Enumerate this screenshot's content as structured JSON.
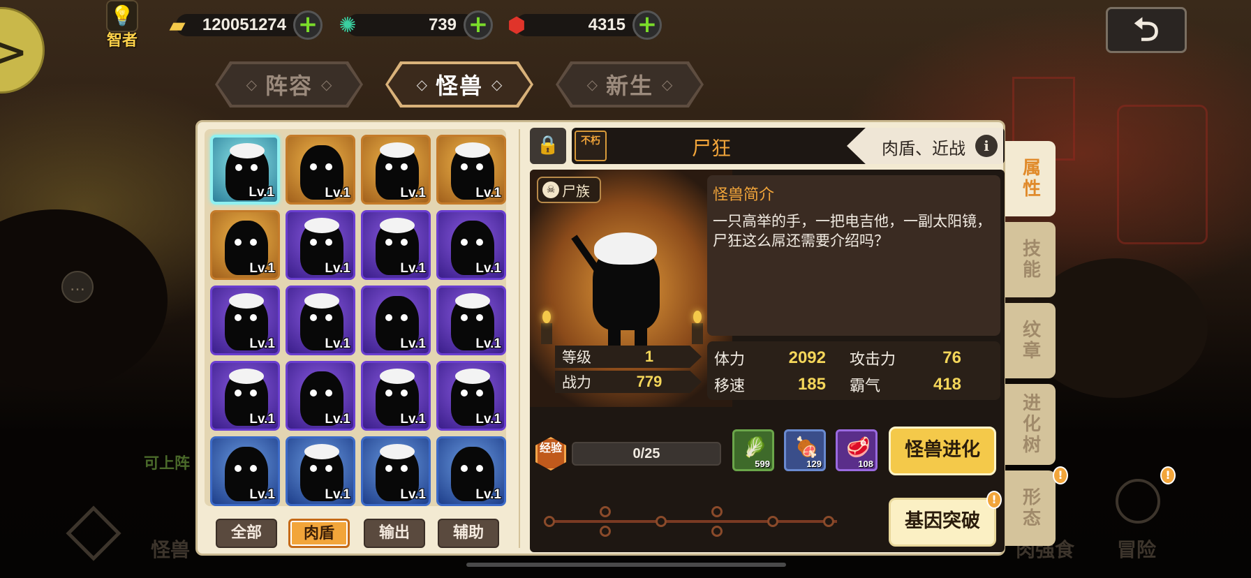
{
  "topbar": {
    "rank_label": "智者",
    "gold": "120051274",
    "gems_green": "739",
    "gems_red": "4315",
    "plus": "+"
  },
  "tabs": [
    {
      "label": "阵容",
      "active": false
    },
    {
      "label": "怪兽",
      "active": true
    },
    {
      "label": "新生",
      "active": false
    }
  ],
  "roster": {
    "cards": [
      {
        "rarity": "selected",
        "level": "Lv.1"
      },
      {
        "rarity": "gold",
        "level": "Lv.1"
      },
      {
        "rarity": "gold",
        "level": "Lv.1"
      },
      {
        "rarity": "gold",
        "level": "Lv.1"
      },
      {
        "rarity": "gold",
        "level": "Lv.1"
      },
      {
        "rarity": "purple",
        "level": "Lv.1"
      },
      {
        "rarity": "purple",
        "level": "Lv.1"
      },
      {
        "rarity": "purple",
        "level": "Lv.1"
      },
      {
        "rarity": "purple",
        "level": "Lv.1"
      },
      {
        "rarity": "purple",
        "level": "Lv.1"
      },
      {
        "rarity": "purple",
        "level": "Lv.1"
      },
      {
        "rarity": "purple",
        "level": "Lv.1"
      },
      {
        "rarity": "purple",
        "level": "Lv.1"
      },
      {
        "rarity": "purple",
        "level": "Lv.1"
      },
      {
        "rarity": "purple",
        "level": "Lv.1"
      },
      {
        "rarity": "purple",
        "level": "Lv.1"
      },
      {
        "rarity": "blue",
        "level": "Lv.1"
      },
      {
        "rarity": "blue",
        "level": "Lv.1"
      },
      {
        "rarity": "blue",
        "level": "Lv.1"
      },
      {
        "rarity": "blue",
        "level": "Lv.1"
      }
    ],
    "filters": [
      {
        "label": "全部",
        "active": false
      },
      {
        "label": "肉盾",
        "active": true
      },
      {
        "label": "输出",
        "active": false
      },
      {
        "label": "辅助",
        "active": false
      }
    ]
  },
  "detail": {
    "tag": "不朽",
    "name": "尸狂",
    "type": "肉盾、近战",
    "info": "i",
    "race": "尸族",
    "intro_title": "怪兽简介",
    "intro_text": "一只高举的手，一把电吉他，一副太阳镜，尸狂这么屌还需要介绍吗？",
    "level_label": "等级",
    "level_value": "1",
    "power_label": "战力",
    "power_value": "779",
    "stats": {
      "hp_label": "体力",
      "hp": "2092",
      "atk_label": "攻击力",
      "atk": "76",
      "spd_label": "移速",
      "spd": "185",
      "dom_label": "霸气",
      "dom": "418"
    },
    "exp_icon": "经验",
    "exp": "0/25",
    "foods": [
      {
        "icon": "vegetable-icon",
        "count": "599",
        "rarity": "green"
      },
      {
        "icon": "meat-leg-icon",
        "count": "129",
        "rarity": "blue"
      },
      {
        "icon": "steak-icon",
        "count": "108",
        "rarity": "purple"
      }
    ],
    "evolve_button": "怪兽进化",
    "gene_button": "基因突破"
  },
  "right_tabs": [
    {
      "label": "属性",
      "active": true
    },
    {
      "label": "技能",
      "active": false
    },
    {
      "label": "纹章",
      "active": false
    },
    {
      "label": "进化树",
      "active": false
    },
    {
      "label": "形态",
      "active": false
    }
  ],
  "background": {
    "labels": [
      "可上阵",
      "怪兽",
      "肉强食",
      "冒险"
    ]
  }
}
